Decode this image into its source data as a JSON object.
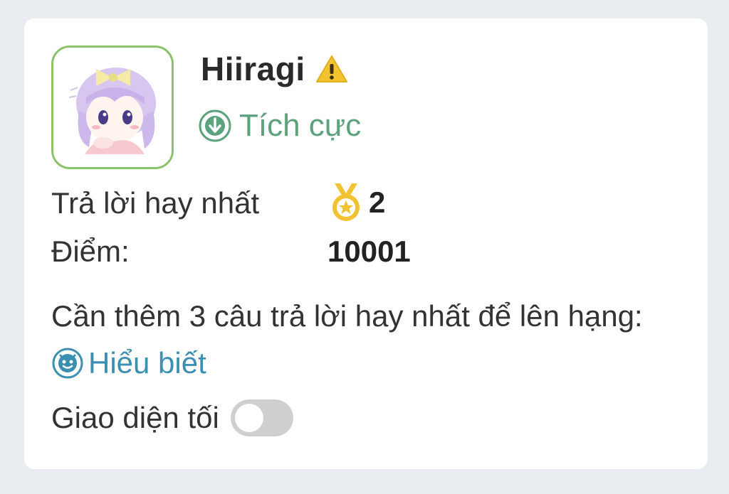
{
  "profile": {
    "username": "Hiiragi",
    "rank": "Tích cực",
    "avatar_icon": "anime-avatar",
    "warning_icon": "warning-icon",
    "colors": {
      "avatar_border": "#8dc26b",
      "rank": "#5aa37d",
      "next_rank": "#3d8fb2",
      "warning": "#f2c230",
      "medal": "#f2c230"
    }
  },
  "stats": {
    "best_answers_label": "Trả lời hay nhất",
    "best_answers_value": "2",
    "points_label": "Điểm:",
    "points_value": "10001"
  },
  "progress": {
    "note": "Cần thêm 3 câu trả lời hay nhất để lên hạng:",
    "next_rank": "Hiểu biết"
  },
  "settings": {
    "dark_mode_label": "Giao diện tối",
    "dark_mode_on": false
  }
}
